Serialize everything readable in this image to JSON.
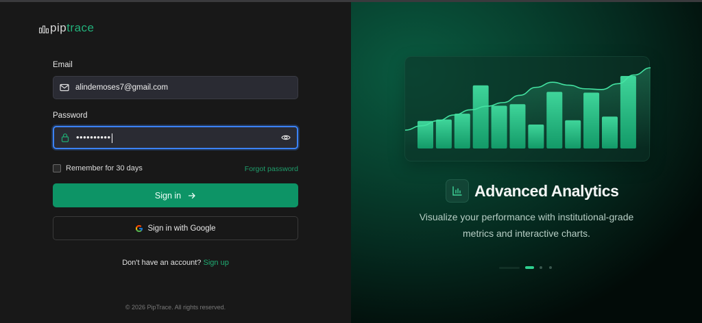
{
  "brand": {
    "name_part1": "pip",
    "name_part2": "trace",
    "accent": "#22b07a"
  },
  "form": {
    "email_label": "Email",
    "email_value": "alindemoses7@gmail.com",
    "password_label": "Password",
    "password_value": "••••••••••",
    "remember_label": "Remember for 30 days",
    "remember_checked": false,
    "forgot_label": "Forgot password",
    "signin_label": "Sign in",
    "google_label": "Sign in with Google",
    "no_account_text": "Don't have an account?",
    "signup_label": "Sign up",
    "copyright": "© 2026 PipTrace. All rights reserved."
  },
  "feature": {
    "title": "Advanced Analytics",
    "description_line1": "Visualize your performance with institutional-grade",
    "description_line2": "metrics and interactive charts.",
    "carousel": {
      "slides": 4,
      "active_index": 1
    }
  },
  "chart_data": {
    "type": "bar",
    "bars": [
      0.38,
      0.4,
      0.48,
      0.87,
      0.59,
      0.61,
      0.33,
      0.78,
      0.39,
      0.77,
      0.44,
      1.0
    ],
    "trend": [
      0.14,
      0.2,
      0.27,
      0.35,
      0.42,
      0.47,
      0.52,
      0.62,
      0.73,
      0.8,
      0.76,
      0.71,
      0.7,
      0.78,
      0.9,
      1.0
    ],
    "colors": {
      "bar_top": "#3fd59a",
      "bar_bottom": "#139a68",
      "line": "#44e3a2"
    }
  },
  "colors": {
    "primary": "#0d9466",
    "link": "#1f9e6c",
    "focus": "#3b82f6"
  },
  "icons": {
    "email": "mail-icon",
    "password": "lock-icon",
    "toggle": "eye-icon",
    "signin": "arrow-right-icon",
    "google": "google-icon",
    "feature": "bar-chart-icon"
  }
}
